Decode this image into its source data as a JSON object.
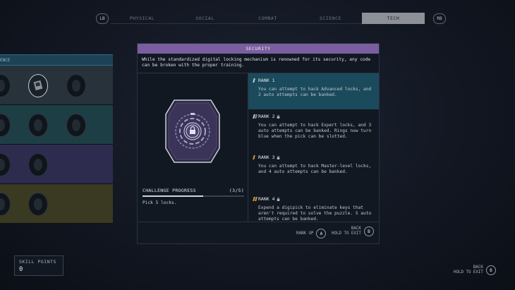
{
  "tabs": {
    "lb": "LB",
    "rb": "RB",
    "items": [
      "PHYSICAL",
      "SOCIAL",
      "COMBAT",
      "SCIENCE",
      "TECH"
    ],
    "active_index": 4
  },
  "tree": {
    "header": "ENCE"
  },
  "panel": {
    "title": "SECURITY",
    "description": "While the standardized digital locking mechanism is renowned for its security, any code can be broken with the proper training.",
    "challenge": {
      "label": "CHALLENGE PROGRESS",
      "count": "(3/5)",
      "progress": 0.6,
      "task": "Pick 5 locks."
    },
    "ranks": [
      {
        "title": "RANK 1",
        "text": "You can attempt to hack Advanced locks, and 2 auto attempts can be banked.",
        "locked": false
      },
      {
        "title": "RANK 2",
        "text": "You can attempt to hack Expert locks, and 3 auto attempts can be banked. Rings now turn blue when the pick can be slotted.",
        "locked": true
      },
      {
        "title": "RANK 3",
        "text": "You can attempt to hack Master-level locks, and 4 auto attempts can be banked.",
        "locked": true
      },
      {
        "title": "RANK 4",
        "text": "Expend a digipick to eliminate keys that aren't required to solve the puzzle. 5 auto attempts can be banked.",
        "locked": true
      }
    ],
    "footer": {
      "rank_up_label": "RANK UP",
      "rank_up_key": "A",
      "back_label": "BACK",
      "back_sub": "HOLD TO EXIT",
      "back_key": "B"
    }
  },
  "skill_points": {
    "label": "SKILL POINTS",
    "value": "0"
  },
  "corner": {
    "back_label": "BACK",
    "back_sub": "HOLD TO EXIT",
    "back_key": "B"
  },
  "colors": {
    "accent_purple": "#7a5ea0",
    "active_rank": "#1b4a5c",
    "locked_orange": "#d49a3a"
  }
}
